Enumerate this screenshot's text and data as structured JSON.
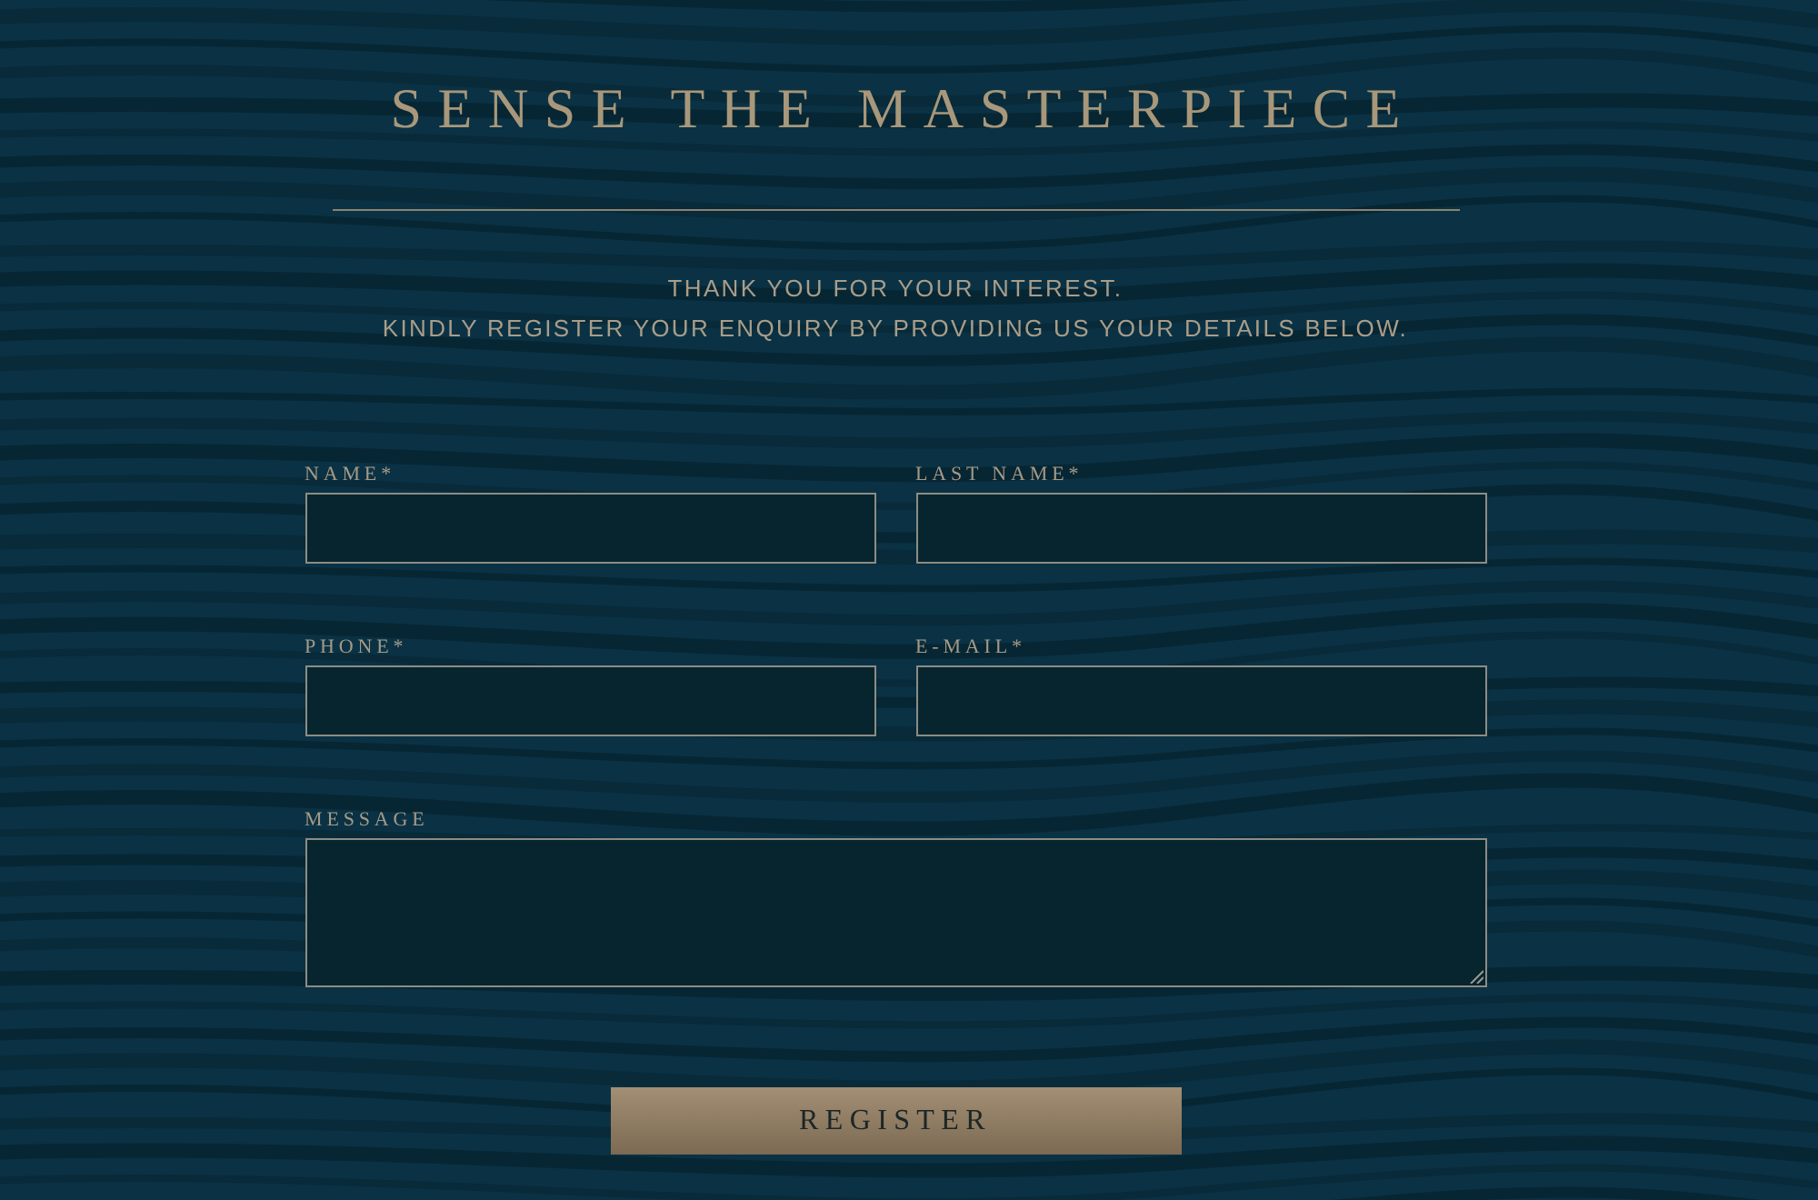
{
  "title": "SENSE THE MASTERPIECE",
  "intro": [
    "THANK YOU FOR YOUR INTEREST.",
    "KINDLY REGISTER YOUR ENQUIRY BY PROVIDING US YOUR DETAILS BELOW."
  ],
  "form": {
    "fields": [
      {
        "label": "NAME*",
        "kind": "input"
      },
      {
        "label": "LAST NAME*",
        "kind": "input"
      },
      {
        "label": "PHONE*",
        "kind": "input"
      },
      {
        "label": "E-MAIL*",
        "kind": "input"
      },
      {
        "label": "MESSAGE",
        "kind": "textarea"
      }
    ],
    "submit": "REGISTER"
  }
}
